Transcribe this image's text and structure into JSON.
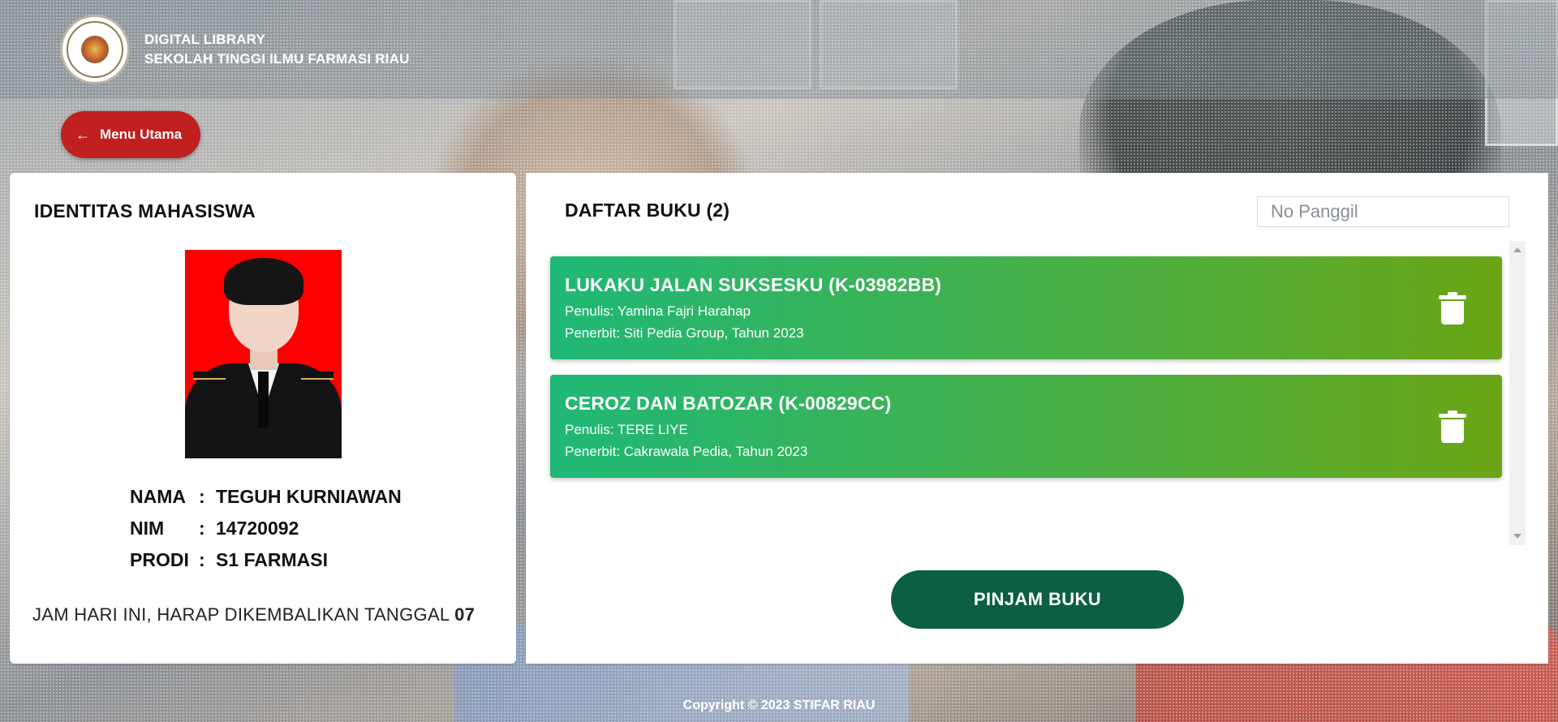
{
  "header": {
    "line1": "DIGITAL LIBRARY",
    "line2": "SEKOLAH TINGGI ILMU FARMASI RIAU"
  },
  "nav": {
    "back_label": "Menu Utama"
  },
  "student": {
    "title": "IDENTITAS MAHASISWA",
    "fields": [
      {
        "key": "NAMA",
        "sep": ":",
        "value": "TEGUH KURNIAWAN"
      },
      {
        "key": "NIM",
        "sep": ":",
        "value": "14720092"
      },
      {
        "key": "PRODI",
        "sep": ":",
        "value": "S1 FARMASI"
      }
    ],
    "notice_text": "JAM HARI INI, HARAP DIKEMBALIKAN TANGGAL ",
    "notice_bold": "07 "
  },
  "books": {
    "title": "DAFTAR BUKU (2)",
    "search_placeholder": "No Panggil",
    "items": [
      {
        "title": "LUKAKU JALAN SUKSESKU (K-03982BB)",
        "author": "Penulis: Yamina Fajri Harahap",
        "publisher": "Penerbit: Siti Pedia Group, Tahun 2023"
      },
      {
        "title": "CEROZ DAN BATOZAR (K-00829CC)",
        "author": "Penulis: TERE LIYE",
        "publisher": "Penerbit: Cakrawala Pedia, Tahun 2023"
      }
    ],
    "submit_label": "PINJAM BUKU"
  },
  "footer": {
    "copyright": "Copyright © 2023 STIFAR RIAU"
  },
  "colors": {
    "back_button": "#c0201f",
    "book_card_start": "#1fb877",
    "book_card_end": "#6aa515",
    "submit_button": "#0b5f44"
  },
  "icons": [
    "arrow-left-icon",
    "trash-icon",
    "trash-icon"
  ]
}
